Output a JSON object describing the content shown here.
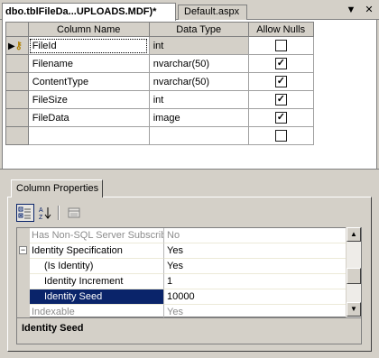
{
  "tabs": {
    "active": "dbo.tblFileDa...UPLOADS.MDF)*",
    "inactive": "Default.aspx",
    "dropdown_glyph": "▼",
    "close_glyph": "✕"
  },
  "grid": {
    "headers": [
      "Column Name",
      "Data Type",
      "Allow Nulls"
    ],
    "rows": [
      {
        "name": "FileId",
        "type": "int",
        "allow_nulls": false,
        "key": true
      },
      {
        "name": "Filename",
        "type": "nvarchar(50)",
        "allow_nulls": true
      },
      {
        "name": "ContentType",
        "type": "nvarchar(50)",
        "allow_nulls": true
      },
      {
        "name": "FileSize",
        "type": "int",
        "allow_nulls": true
      },
      {
        "name": "FileData",
        "type": "image",
        "allow_nulls": true
      },
      {
        "name": "",
        "type": "",
        "allow_nulls": false
      }
    ]
  },
  "column_properties": {
    "tab_label": "Column Properties",
    "toolbar": {
      "categorized_icon": "categorized-icon",
      "alphabetical_icon": "alphabetical-icon",
      "property_pages_icon": "property-pages-icon"
    },
    "properties": [
      {
        "name": "Has Non-SQL Server Subscribe",
        "value": "No",
        "disabled": true
      },
      {
        "name": "Identity Specification",
        "value": "Yes",
        "expander": "−"
      },
      {
        "name": "(Is Identity)",
        "value": "Yes",
        "indent": true
      },
      {
        "name": "Identity Increment",
        "value": "1",
        "indent": true
      },
      {
        "name": "Identity Seed",
        "value": "10000",
        "indent": true,
        "selected": true
      },
      {
        "name": "Indexable",
        "value": "Yes",
        "disabled": true
      }
    ],
    "description": "Identity Seed"
  },
  "colors": {
    "selection": "#0a246a",
    "chrome": "#d4d0c8"
  }
}
